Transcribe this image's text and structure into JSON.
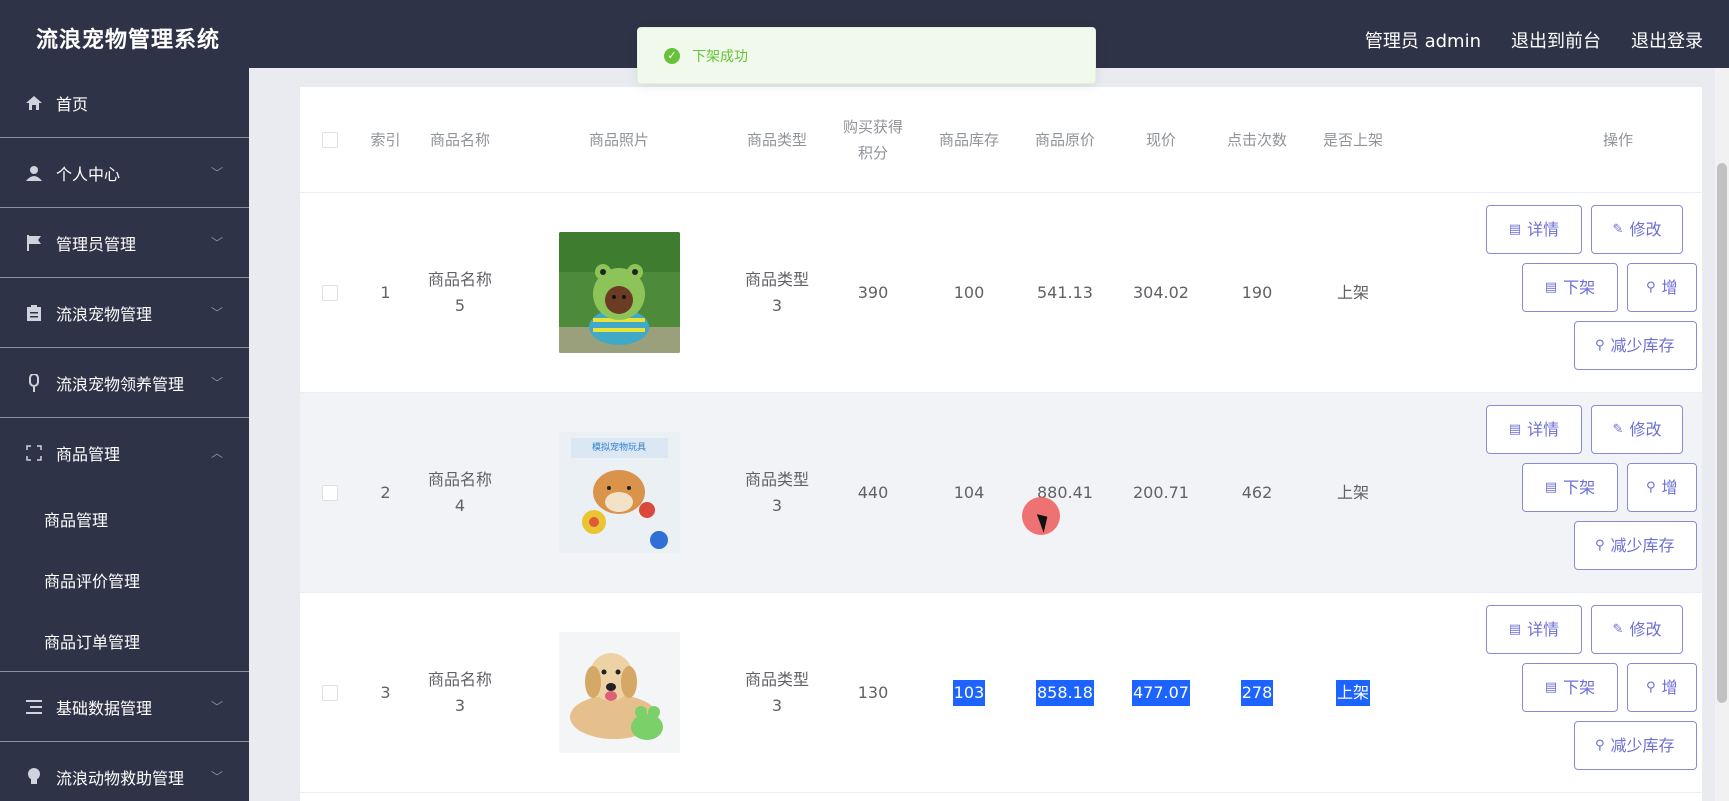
{
  "header": {
    "title": "流浪宠物管理系统",
    "admin_label": "管理员 admin",
    "to_front": "退出到前台",
    "logout": "退出登录"
  },
  "toast": {
    "message": "下架成功",
    "color": "#67c23a"
  },
  "sidebar": {
    "items": [
      {
        "label": "首页",
        "icon": "home-icon"
      },
      {
        "label": "个人中心",
        "icon": "user-icon"
      },
      {
        "label": "管理员管理",
        "icon": "flag-icon"
      },
      {
        "label": "流浪宠物管理",
        "icon": "clipboard-icon"
      },
      {
        "label": "流浪宠物领养管理",
        "icon": "mic-icon"
      },
      {
        "label": "商品管理",
        "icon": "frame-icon"
      }
    ],
    "sub_items": [
      {
        "label": "商品管理"
      },
      {
        "label": "商品评价管理"
      },
      {
        "label": "商品订单管理"
      }
    ],
    "bottom_items": [
      {
        "label": "基础数据管理",
        "icon": "list-icon"
      },
      {
        "label": "流浪动物救助管理",
        "icon": "bulb-icon"
      }
    ]
  },
  "table": {
    "headers": {
      "index": "索引",
      "name": "商品名称",
      "photo": "商品照片",
      "type": "商品类型",
      "points_a": "购买获得",
      "points_b": "积分",
      "stock": "商品库存",
      "orig_price": "商品原价",
      "price": "现价",
      "clicks": "点击次数",
      "on_shelf": "是否上架",
      "ops": "操作"
    },
    "rows": [
      {
        "index": "1",
        "name_a": "商品名称",
        "name_b": "5",
        "type_a": "商品类型",
        "type_b": "3",
        "points": "390",
        "stock": "100",
        "orig_price": "541.13",
        "price": "304.02",
        "clicks": "190",
        "on_shelf": "上架"
      },
      {
        "index": "2",
        "name_a": "商品名称",
        "name_b": "4",
        "type_a": "商品类型",
        "type_b": "3",
        "points": "440",
        "stock": "104",
        "orig_price": "880.41",
        "price": "200.71",
        "clicks": "462",
        "on_shelf": "上架"
      },
      {
        "index": "3",
        "name_a": "商品名称",
        "name_b": "3",
        "type_a": "商品类型",
        "type_b": "3",
        "points": "130",
        "stock": "103",
        "orig_price": "858.18",
        "price": "477.07",
        "clicks": "278",
        "on_shelf": "上架"
      }
    ],
    "buttons": {
      "detail": "详情",
      "edit": "修改",
      "off_shelf": "下架",
      "add_stock": "增",
      "reduce_stock": "减少库存"
    },
    "banner_text": "模拟宠物玩具"
  },
  "colors": {
    "sidebar_bg": "#2f3347",
    "accent": "#6c6fd4",
    "highlight": "#1d63ff"
  }
}
